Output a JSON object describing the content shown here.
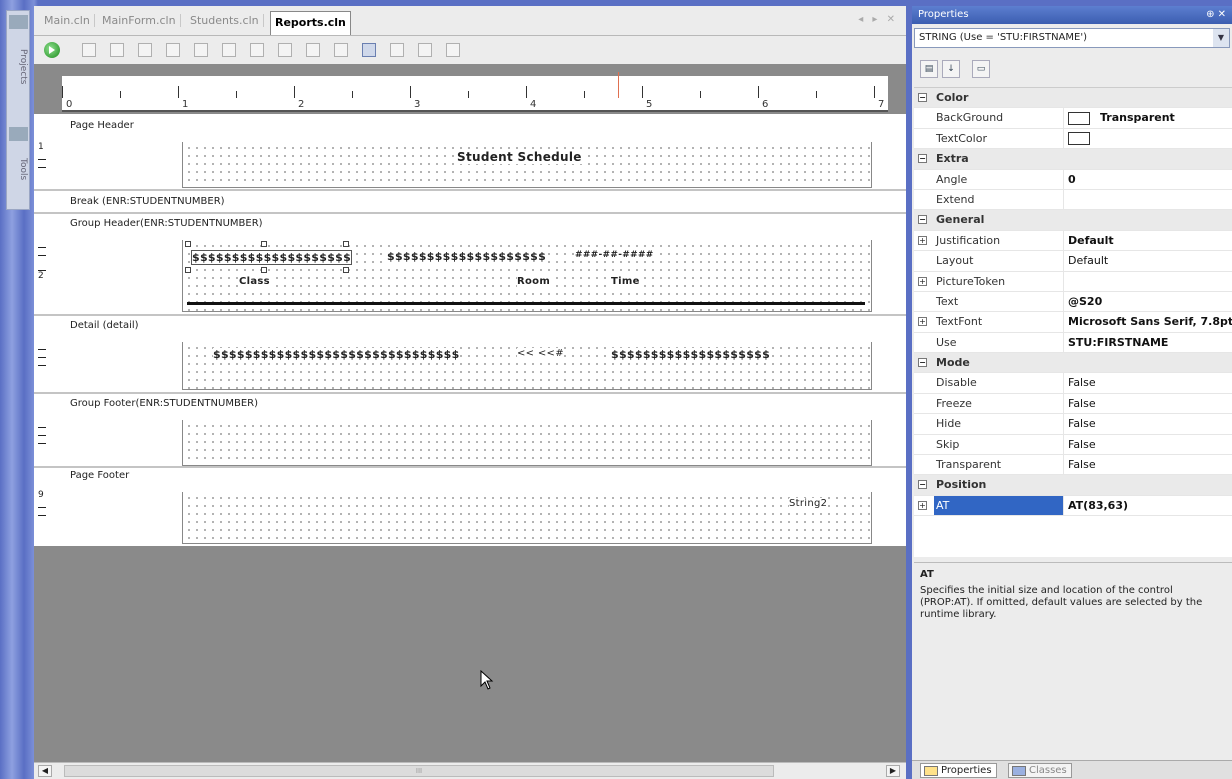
{
  "leftdock": {
    "tabs": [
      "Projects",
      "Tools"
    ]
  },
  "designer": {
    "tabs": [
      {
        "label": "Main.cln",
        "active": false
      },
      {
        "label": "MainForm.cln",
        "active": false
      },
      {
        "label": "Students.cln",
        "active": false
      },
      {
        "label": "Reports.cln",
        "active": true
      }
    ],
    "tab_controls": "◂ ▸ ✕",
    "ruler_numbers": [
      "0",
      "1",
      "2",
      "3",
      "4",
      "5",
      "6",
      "7"
    ],
    "bands": {
      "page_header": {
        "label": "Page Header",
        "title": "Student Schedule",
        "marker": "1"
      },
      "break": {
        "label": "Break (ENR:STUDENTNUMBER)"
      },
      "group_header": {
        "label": "Group Header(ENR:STUDENTNUMBER)",
        "marker": "2",
        "field1": "$$$$$$$$$$$$$$$$$$$$",
        "field2": "$$$$$$$$$$$$$$$$$$$$",
        "field3": "###-##-####",
        "col_class": "Class",
        "col_room": "Room",
        "col_time": "Time"
      },
      "detail": {
        "label": "Detail (detail)",
        "field1": "$$$$$$$$$$$$$$$$$$$$$$$$$$$$$$$",
        "field2": "<< <<#",
        "field3": "$$$$$$$$$$$$$$$$$$$$"
      },
      "group_footer": {
        "label": "Group Footer(ENR:STUDENTNUMBER)"
      },
      "page_footer": {
        "label": "Page Footer",
        "marker": "9",
        "field": "String2"
      }
    },
    "scroll_mid": "III"
  },
  "properties": {
    "title": "Properties",
    "title_controls": "⊕ ✕",
    "object": "STRING (Use = 'STU:FIRSTNAME')",
    "rows": [
      {
        "type": "cat",
        "key": "Color"
      },
      {
        "key": "BackGround",
        "value": "Transparent",
        "swatch": true,
        "bold": true
      },
      {
        "key": "TextColor",
        "value": "",
        "swatch": true
      },
      {
        "type": "cat",
        "key": "Extra"
      },
      {
        "key": "Angle",
        "value": "0",
        "bold": true
      },
      {
        "key": "Extend",
        "value": ""
      },
      {
        "type": "cat",
        "key": "General"
      },
      {
        "key": "Justification",
        "value": "Default",
        "bold": true,
        "expand": true
      },
      {
        "key": "Layout",
        "value": "Default"
      },
      {
        "key": "PictureToken",
        "value": "",
        "expand": true
      },
      {
        "key": "Text",
        "value": "@S20",
        "bold": true
      },
      {
        "key": "TextFont",
        "value": "Microsoft Sans Serif, 7.8pt",
        "bold": true,
        "expand": true
      },
      {
        "key": "Use",
        "value": "STU:FIRSTNAME",
        "bold": true
      },
      {
        "type": "cat",
        "key": "Mode"
      },
      {
        "key": "Disable",
        "value": "False"
      },
      {
        "key": "Freeze",
        "value": "False"
      },
      {
        "key": "Hide",
        "value": "False"
      },
      {
        "key": "Skip",
        "value": "False"
      },
      {
        "key": "Transparent",
        "value": "False"
      },
      {
        "type": "cat",
        "key": "Position"
      },
      {
        "key": "AT",
        "value": "AT(83,63)",
        "bold": true,
        "expand": true,
        "highlight": true
      }
    ],
    "desc_title": "AT",
    "desc_text": "Specifies the initial size and location of the control (PROP:AT). If omitted, default values are selected by the runtime library.",
    "bottom_tabs": [
      "Properties",
      "Classes"
    ]
  }
}
